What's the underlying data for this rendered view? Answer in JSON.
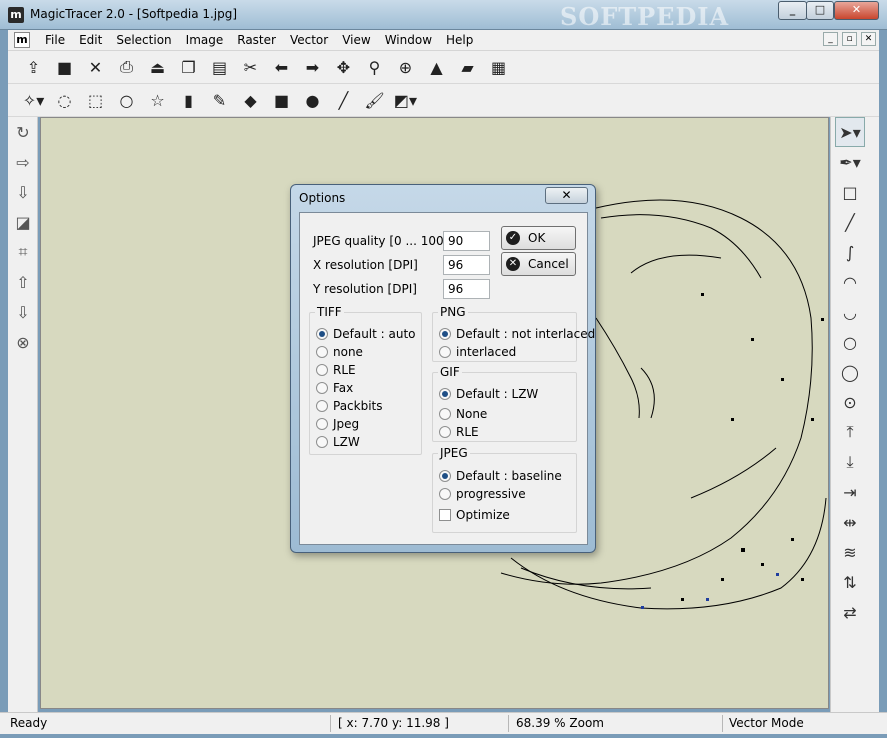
{
  "window": {
    "title": "MagicTracer 2.0 - [Softpedia 1.jpg]",
    "app_icon": "m",
    "watermark": "SOFTPEDIA",
    "controls": [
      "_",
      "□",
      "✕"
    ]
  },
  "menubar": {
    "doc_icon": "m",
    "items": [
      "File",
      "Edit",
      "Selection",
      "Image",
      "Raster",
      "Vector",
      "View",
      "Window",
      "Help"
    ],
    "mdi_controls": [
      "_",
      "▫",
      "✕"
    ]
  },
  "toolbar1": {
    "icons": [
      "open-icon",
      "save-icon",
      "close-icon",
      "print-icon",
      "scan-icon",
      "copy-icon",
      "paste-icon",
      "cut-icon",
      "undo-arrow-icon",
      "redo-arrow-icon",
      "move-icon",
      "zoom-icon",
      "zoom-fit-icon",
      "image-icon",
      "layers-icon",
      "grid-icon"
    ]
  },
  "toolbar2": {
    "icons": [
      "magic-wand-icon",
      "lasso-icon",
      "rect-select-icon",
      "ellipse-select-icon",
      "polygon-select-icon",
      "eraser-icon",
      "pencil-icon",
      "fill-icon",
      "rectangle-icon",
      "circle-icon",
      "line-icon",
      "brush-icon",
      "color-picker-icon"
    ]
  },
  "left_toolbar": {
    "icons": [
      "rotate-icon",
      "export-icon",
      "import-icon",
      "resize-icon",
      "crop-icon",
      "move-up-icon",
      "move-down-icon",
      "cancel-icon"
    ]
  },
  "right_toolbar": {
    "icons": [
      "pointer-icon",
      "pen-icon",
      "rectangle-icon",
      "line-icon",
      "curve-icon",
      "arc-icon",
      "arc-alt-icon",
      "circle-icon",
      "circle-alt-icon",
      "circle-center-icon",
      "align-top-icon",
      "align-bottom-icon",
      "join-icon",
      "split-icon",
      "merge-icon",
      "flip-vertical-icon",
      "flip-horizontal-icon"
    ]
  },
  "status": {
    "ready": "Ready",
    "coords": "[ x: 7.70 y: 11.98 ]",
    "zoom": "68.39 % Zoom",
    "mode": "Vector Mode"
  },
  "dialog": {
    "title": "Options",
    "close_label": "✕",
    "jpeg_quality_label": "JPEG quality [0 ... 100]",
    "jpeg_quality_value": "90",
    "xres_label": "X resolution [DPI]",
    "xres_value": "96",
    "yres_label": "Y resolution [DPI]",
    "yres_value": "96",
    "ok_label": "OK",
    "cancel_label": "Cancel",
    "tiff": {
      "title": "TIFF",
      "options": [
        "Default : auto",
        "none",
        "RLE",
        "Fax",
        "Packbits",
        "Jpeg",
        "LZW"
      ],
      "selected": 0
    },
    "png": {
      "title": "PNG",
      "options": [
        "Default : not interlaced",
        "interlaced"
      ],
      "selected": 0
    },
    "gif": {
      "title": "GIF",
      "options": [
        "Default : LZW",
        "None",
        "RLE"
      ],
      "selected": 0
    },
    "jpeg": {
      "title": "JPEG",
      "options": [
        "Default : baseline",
        "progressive"
      ],
      "selected": 0,
      "optimize_label": "Optimize",
      "optimize_checked": false
    }
  }
}
